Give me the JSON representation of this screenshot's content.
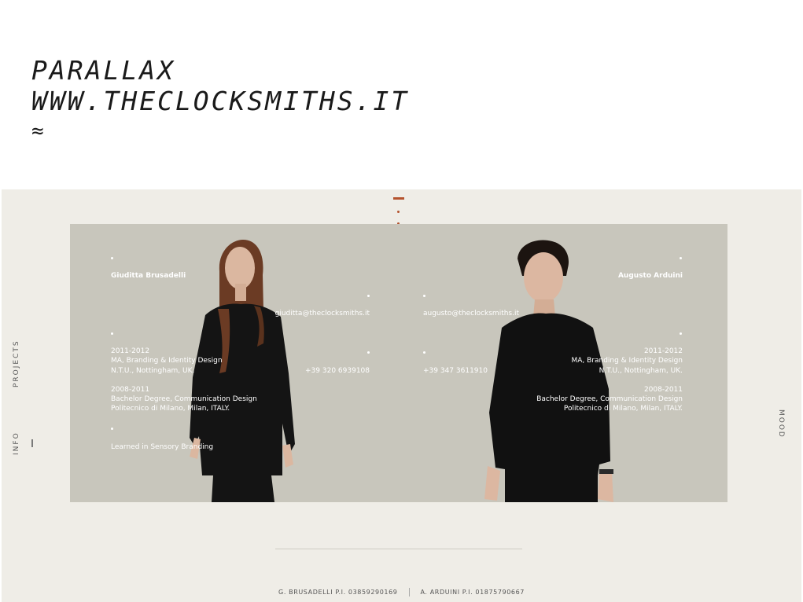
{
  "caption": {
    "line1": "PARALLAX",
    "line2": "WWW.THECLOCKSMITHS.IT",
    "symbol": "≈"
  },
  "site": {
    "accent_color": "#b4532e",
    "background_color": "#efede7",
    "panel_color": "#c8c6bc",
    "nav": {
      "projects": "PROJECTS",
      "info": "INFO",
      "mood": "MOOD"
    },
    "left_person": {
      "name": "Giuditta Brusadelli",
      "email": "giuditta@theclocksmiths.it",
      "phone": "+39 320 6939108",
      "edu1_years": "2011-2012",
      "edu1_degree": "MA, Branding & Identity Design",
      "edu1_school": "N.T.U., Nottingham, UK.",
      "edu2_years": "2008-2011",
      "edu2_degree": "Bachelor Degree, Communication Design",
      "edu2_school": "Politecnico di Milano, Milan, ITALY.",
      "note": "Learned in Sensory Branding"
    },
    "right_person": {
      "name": "Augusto Arduini",
      "email": "augusto@theclocksmiths.it",
      "phone": "+39 347 3611910",
      "edu1_years": "2011-2012",
      "edu1_degree": "MA, Branding & Identity Design",
      "edu1_school": "N.T.U., Nottingham, UK.",
      "edu2_years": "2008-2011",
      "edu2_degree": "Bachelor Degree, Communication Design",
      "edu2_school": "Politecnico di Milano, Milan, ITALY."
    },
    "footer": {
      "left": "G. BRUSADELLI P.I. 03859290169",
      "right": "A. ARDUINI P.I. 01875790667"
    }
  }
}
